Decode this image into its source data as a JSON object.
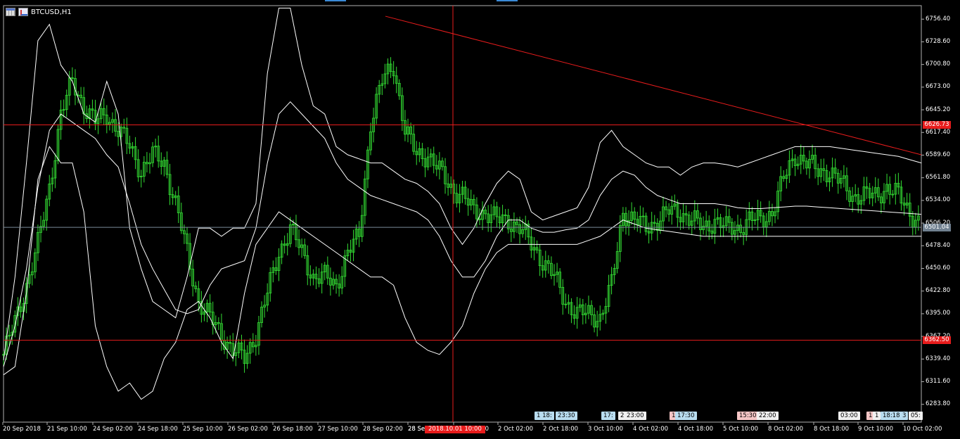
{
  "window": {
    "symbol_title": "BTCUSD,H1"
  },
  "colors": {
    "background": "#000000",
    "candles": "#33dd33",
    "bands": "#ffffff",
    "hlines": "#e81c1c",
    "current_price_line": "#7a8a99",
    "crosshair": "#e81c1c",
    "trendline": "#e81c1c"
  },
  "chart_data": {
    "type": "line",
    "title": "BTCUSD,H1",
    "timeframe": "H1",
    "indicators": [
      "Bollinger Bands (upper, middle, lower)"
    ],
    "y_ticks": [
      "6756.40",
      "6728.60",
      "6700.80",
      "6673.00",
      "6645.20",
      "6617.40",
      "6589.60",
      "6561.80",
      "6534.00",
      "6506.20",
      "6478.40",
      "6450.60",
      "6422.80",
      "6395.00",
      "6367.20",
      "6339.40",
      "6311.60",
      "6283.80"
    ],
    "ylim": [
      6262.0,
      6773.0
    ],
    "x_ticks": [
      "20 Sep 2018",
      "21 Sep 10:00",
      "24 Sep 02:00",
      "24 Sep 18:00",
      "25 Sep 10:00",
      "26 Sep 02:00",
      "26 Sep 18:00",
      "27 Sep 10:00",
      "28 Sep 02:00",
      "28 Sep 18:00",
      "1 Oct 10:00",
      "2 Oct 02:00",
      "2 Oct 18:00",
      "3 Oct 10:00",
      "4 Oct 02:00",
      "4 Oct 18:00",
      "5 Oct 10:00",
      "8 Oct 02:00",
      "8 Oct 18:00",
      "9 Oct 10:00",
      "10 Oct 02:00"
    ],
    "x_partial_tick": "28 Sep",
    "horizontal_lines": [
      {
        "price": 6626.73,
        "label": "6626.73"
      },
      {
        "price": 6362.5,
        "label": "6362.50"
      }
    ],
    "current_price": {
      "price": 6501.04,
      "label": "6501.04"
    },
    "crosshair": {
      "time_label": "2018.10.01 10:00"
    },
    "trendline": {
      "from": {
        "time": "28 Sep 02:00",
        "price": 6760.0
      },
      "to": {
        "time": "10 Oct 02:00",
        "price": 6590.0
      }
    },
    "series": [
      {
        "name": "close",
        "x": [
          0,
          4,
          8,
          12,
          16,
          20,
          24,
          28,
          32,
          36,
          40,
          44,
          48,
          52,
          56,
          60,
          64,
          68,
          72,
          76,
          80,
          84,
          88,
          92,
          96,
          100,
          104,
          108,
          112,
          116,
          120,
          124,
          128,
          132,
          136,
          140,
          144,
          148,
          152,
          156,
          160,
          164,
          168,
          172,
          176,
          180,
          184,
          188,
          192,
          196,
          200,
          204,
          208,
          212,
          216,
          220,
          224,
          228,
          232,
          236,
          240,
          244,
          248,
          252,
          256,
          260,
          264,
          268,
          272,
          276,
          280,
          284,
          288,
          292,
          296,
          300,
          304,
          308,
          312,
          316,
          320
        ],
        "values": [
          6345,
          6385,
          6430,
          6480,
          6550,
          6640,
          6680,
          6650,
          6630,
          6640,
          6620,
          6600,
          6570,
          6590,
          6580,
          6530,
          6470,
          6410,
          6390,
          6370,
          6350,
          6340,
          6370,
          6420,
          6470,
          6500,
          6470,
          6440,
          6440,
          6430,
          6470,
          6490,
          6630,
          6680,
          6700,
          6620,
          6590,
          6590,
          6570,
          6550,
          6540,
          6520,
          6520,
          6510,
          6510,
          6500,
          6480,
          6460,
          6440,
          6410,
          6395,
          6395,
          6390,
          6430,
          6520,
          6510,
          6500,
          6510,
          6520,
          6520,
          6510,
          6500,
          6510,
          6500,
          6500,
          6510,
          6510,
          6520,
          6560,
          6590,
          6580,
          6570,
          6570,
          6555,
          6540,
          6540,
          6540,
          6550,
          6540,
          6520,
          6503
        ]
      },
      {
        "name": "BB upper",
        "x": [
          0,
          4,
          8,
          12,
          16,
          20,
          24,
          28,
          32,
          36,
          40,
          44,
          48,
          52,
          56,
          60,
          64,
          68,
          72,
          76,
          80,
          84,
          88,
          92,
          96,
          100,
          104,
          108,
          112,
          116,
          120,
          124,
          128,
          132,
          136,
          140,
          144,
          148,
          152,
          156,
          160,
          164,
          168,
          172,
          176,
          180,
          184,
          188,
          192,
          196,
          200,
          204,
          208,
          212,
          216,
          220,
          224,
          228,
          232,
          236,
          240,
          244,
          248,
          252,
          256,
          260,
          264,
          268,
          272,
          276,
          280,
          284,
          288,
          292,
          296,
          300,
          304,
          308,
          312,
          316,
          320
        ],
        "values": [
          6338,
          6440,
          6580,
          6730,
          6750,
          6700,
          6680,
          6640,
          6630,
          6680,
          6640,
          6500,
          6450,
          6410,
          6400,
          6390,
          6440,
          6500,
          6500,
          6490,
          6500,
          6500,
          6530,
          6690,
          6770,
          6770,
          6700,
          6650,
          6640,
          6600,
          6590,
          6585,
          6580,
          6580,
          6570,
          6560,
          6555,
          6545,
          6530,
          6500,
          6480,
          6500,
          6530,
          6555,
          6570,
          6560,
          6520,
          6510,
          6515,
          6520,
          6525,
          6550,
          6605,
          6620,
          6600,
          6590,
          6580,
          6575,
          6575,
          6565,
          6575,
          6580,
          6580,
          6578,
          6575,
          6580,
          6585,
          6590,
          6595,
          6600,
          6600,
          6600,
          6600,
          6598,
          6596,
          6594,
          6592,
          6590,
          6588,
          6584,
          6580
        ]
      },
      {
        "name": "BB middle",
        "x": [
          0,
          4,
          8,
          12,
          16,
          20,
          24,
          28,
          32,
          36,
          40,
          44,
          48,
          52,
          56,
          60,
          64,
          68,
          72,
          76,
          80,
          84,
          88,
          92,
          96,
          100,
          104,
          108,
          112,
          116,
          120,
          124,
          128,
          132,
          136,
          140,
          144,
          148,
          152,
          156,
          160,
          164,
          168,
          172,
          176,
          180,
          184,
          188,
          192,
          196,
          200,
          204,
          208,
          212,
          216,
          220,
          224,
          228,
          232,
          236,
          240,
          244,
          248,
          252,
          256,
          260,
          264,
          268,
          272,
          276,
          280,
          284,
          288,
          292,
          296,
          300,
          304,
          308,
          312,
          316,
          320
        ],
        "values": [
          6330,
          6380,
          6450,
          6550,
          6620,
          6640,
          6630,
          6620,
          6610,
          6590,
          6575,
          6530,
          6480,
          6450,
          6425,
          6400,
          6395,
          6400,
          6430,
          6450,
          6455,
          6460,
          6500,
          6580,
          6640,
          6655,
          6640,
          6625,
          6610,
          6580,
          6560,
          6550,
          6540,
          6535,
          6530,
          6525,
          6520,
          6510,
          6490,
          6460,
          6440,
          6440,
          6460,
          6490,
          6510,
          6510,
          6500,
          6495,
          6495,
          6498,
          6500,
          6510,
          6540,
          6560,
          6570,
          6565,
          6550,
          6540,
          6535,
          6530,
          6530,
          6530,
          6530,
          6528,
          6525,
          6524,
          6524,
          6525,
          6526,
          6527,
          6527,
          6526,
          6525,
          6524,
          6523,
          6522,
          6521,
          6520,
          6519,
          6518,
          6517
        ]
      },
      {
        "name": "BB lower",
        "x": [
          0,
          4,
          8,
          12,
          16,
          20,
          24,
          28,
          32,
          36,
          40,
          44,
          48,
          52,
          56,
          60,
          64,
          68,
          72,
          76,
          80,
          84,
          88,
          92,
          96,
          100,
          104,
          108,
          112,
          116,
          120,
          124,
          128,
          132,
          136,
          140,
          144,
          148,
          152,
          156,
          160,
          164,
          168,
          172,
          176,
          180,
          184,
          188,
          192,
          196,
          200,
          204,
          208,
          212,
          216,
          220,
          224,
          228,
          232,
          236,
          240,
          244,
          248,
          252,
          256,
          260,
          264,
          268,
          272,
          276,
          280,
          284,
          288,
          292,
          296,
          300,
          304,
          308,
          312,
          316,
          320
        ],
        "values": [
          6320,
          6330,
          6420,
          6560,
          6600,
          6580,
          6580,
          6520,
          6380,
          6330,
          6300,
          6310,
          6290,
          6300,
          6340,
          6360,
          6400,
          6410,
          6390,
          6360,
          6340,
          6420,
          6480,
          6500,
          6520,
          6510,
          6500,
          6490,
          6480,
          6470,
          6460,
          6450,
          6440,
          6440,
          6430,
          6390,
          6360,
          6350,
          6345,
          6360,
          6380,
          6420,
          6450,
          6470,
          6480,
          6480,
          6480,
          6480,
          6480,
          6480,
          6480,
          6485,
          6490,
          6500,
          6510,
          6505,
          6500,
          6498,
          6496,
          6494,
          6492,
          6490,
          6490,
          6490,
          6490,
          6490,
          6490,
          6490,
          6490,
          6490,
          6490,
          6490,
          6490,
          6490,
          6490,
          6490,
          6490,
          6490,
          6490,
          6490,
          6490
        ]
      }
    ]
  },
  "event_markers": [
    {
      "text": "1 18:",
      "style": "blue"
    },
    {
      "text": "23:30",
      "style": "blue"
    },
    {
      "text": "17:",
      "style": "blue"
    },
    {
      "text": "2",
      "style": "white"
    },
    {
      "text": "23:00",
      "style": "white"
    },
    {
      "text": "1",
      "style": "pink"
    },
    {
      "text": "17:30",
      "style": "blue"
    },
    {
      "text": "15:30",
      "style": "pink"
    },
    {
      "text": "22:00",
      "style": "white"
    },
    {
      "text": "03:00",
      "style": "white"
    },
    {
      "text": "1",
      "style": "pink"
    },
    {
      "text": "1",
      "style": "white"
    },
    {
      "text": "18:18",
      "style": "blue"
    },
    {
      "text": "3",
      "style": "blue"
    },
    {
      "text": "05:",
      "style": "white"
    }
  ]
}
